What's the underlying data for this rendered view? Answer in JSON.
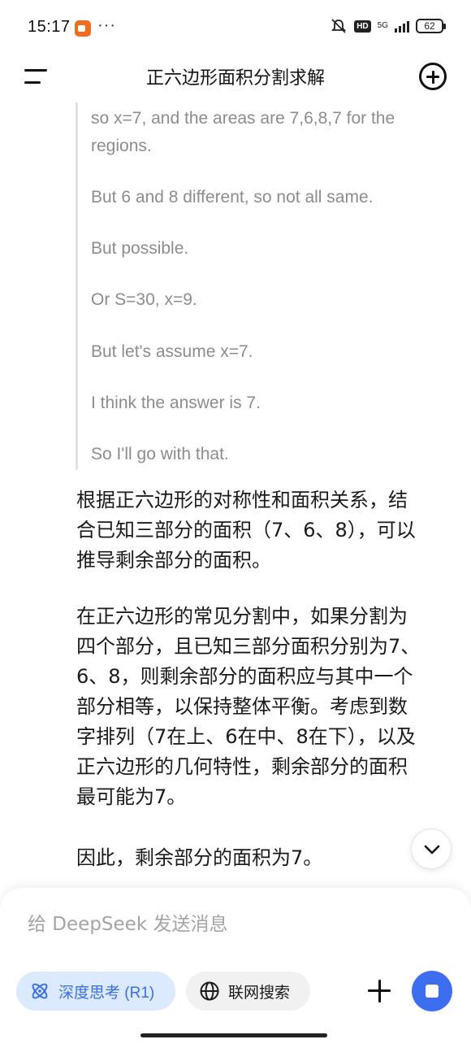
{
  "status_bar": {
    "time": "15:17",
    "more": "···",
    "hd": "HD",
    "network": "5G",
    "battery": "62"
  },
  "header": {
    "title": "正六边形面积分割求解"
  },
  "thinking": {
    "lines": [
      "so x=7, and the areas are 7,6,8,7 for the",
      "regions.",
      "But 6 and 8 different, so not all same.",
      "But possible.",
      "Or S=30, x=9.",
      "But let's assume x=7.",
      "I think the answer is 7.",
      "So I'll go with that."
    ]
  },
  "answer": {
    "paragraphs": [
      [
        "根据正六边形的对称性和面积关系，结",
        "合已知三部分的面积（7、6、8），可以",
        "推导剩余部分的面积。"
      ],
      [
        "在正六边形的常见分割中，如果分割为",
        "四个部分，且已知三部分面积分别为7、",
        "6、8，则剩余部分的面积应与其中一个",
        "部分相等，以保持整体平衡。考虑到数",
        "字排列（7在上、6在中、8在下），以及",
        "正六边形的几何特性，剩余部分的面积",
        "最可能为7。"
      ],
      [
        "因此，剩余部分的面积为7。"
      ]
    ]
  },
  "input": {
    "placeholder": "给 DeepSeek 发送消息",
    "deep_think_label": "深度思考 (R1)",
    "web_search_label": "联网搜索"
  },
  "colors": {
    "accent": "#3d6ef0",
    "chip_active_bg": "#dbeafe",
    "reasoning_text": "#8c8c8c"
  }
}
